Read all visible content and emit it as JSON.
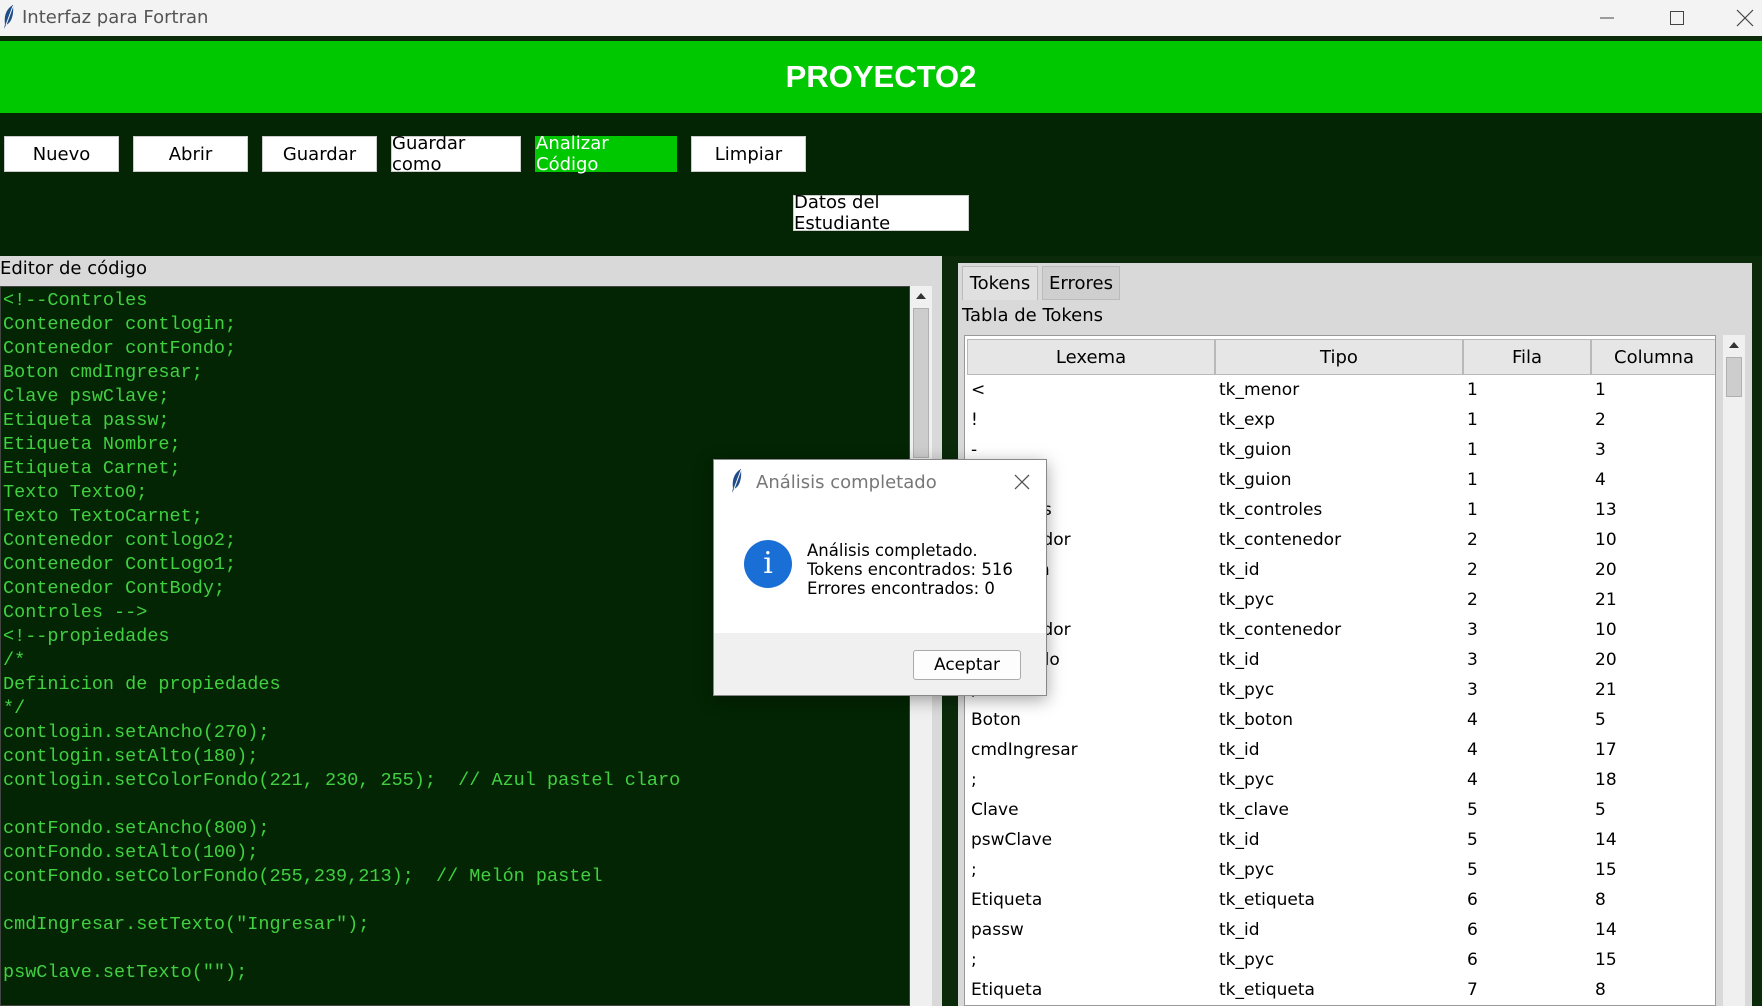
{
  "window": {
    "title": "Interfaz para Fortran"
  },
  "header": {
    "title": "PROYECTO2"
  },
  "toolbar": {
    "nuevo": "Nuevo",
    "abrir": "Abrir",
    "guardar": "Guardar",
    "guardar_como": "Guardar como",
    "analizar": "Analizar Código",
    "limpiar": "Limpiar",
    "datos": "Datos del Estudiante",
    "accent_color": "#00c800"
  },
  "editor": {
    "label": "Editor de código",
    "lines": [
      "<!--Controles",
      "Contenedor contlogin;",
      "Contenedor contFondo;",
      "Boton cmdIngresar;",
      "Clave pswClave;",
      "Etiqueta passw;",
      "Etiqueta Nombre;",
      "Etiqueta Carnet;",
      "Texto Texto0;",
      "Texto TextoCarnet;",
      "Contenedor contlogo2;",
      "Contenedor ContLogo1;",
      "Contenedor ContBody;",
      "Controles -->",
      "<!--propiedades",
      "/*",
      "Definicion de propiedades",
      "*/",
      "contlogin.setAncho(270);",
      "contlogin.setAlto(180);",
      "contlogin.setColorFondo(221, 230, 255);  // Azul pastel claro",
      "",
      "contFondo.setAncho(800);",
      "contFondo.setAlto(100);",
      "contFondo.setColorFondo(255,239,213);  // Melón pastel",
      "",
      "cmdIngresar.setTexto(\"Ingresar\");",
      "",
      "pswClave.setTexto(\"\");"
    ]
  },
  "tabs": {
    "tokens": "Tokens",
    "errores": "Errores"
  },
  "tokens_table": {
    "label": "Tabla de Tokens",
    "headers": {
      "lexema": "Lexema",
      "tipo": "Tipo",
      "fila": "Fila",
      "columna": "Columna"
    },
    "rows": [
      [
        "<",
        "tk_menor",
        "1",
        "1"
      ],
      [
        "!",
        "tk_exp",
        "1",
        "2"
      ],
      [
        "-",
        "tk_guion",
        "1",
        "3"
      ],
      [
        "-",
        "tk_guion",
        "1",
        "4"
      ],
      [
        "Controles",
        "tk_controles",
        "1",
        "13"
      ],
      [
        "Contenedor",
        "tk_contenedor",
        "2",
        "10"
      ],
      [
        "contlogin",
        "tk_id",
        "2",
        "20"
      ],
      [
        ";",
        "tk_pyc",
        "2",
        "21"
      ],
      [
        "Contenedor",
        "tk_contenedor",
        "3",
        "10"
      ],
      [
        "contFondo",
        "tk_id",
        "3",
        "20"
      ],
      [
        ";",
        "tk_pyc",
        "3",
        "21"
      ],
      [
        "Boton",
        "tk_boton",
        "4",
        "5"
      ],
      [
        "cmdIngresar",
        "tk_id",
        "4",
        "17"
      ],
      [
        ";",
        "tk_pyc",
        "4",
        "18"
      ],
      [
        "Clave",
        "tk_clave",
        "5",
        "5"
      ],
      [
        "pswClave",
        "tk_id",
        "5",
        "14"
      ],
      [
        ";",
        "tk_pyc",
        "5",
        "15"
      ],
      [
        "Etiqueta",
        "tk_etiqueta",
        "6",
        "8"
      ],
      [
        "passw",
        "tk_id",
        "6",
        "14"
      ],
      [
        ";",
        "tk_pyc",
        "6",
        "15"
      ],
      [
        "Etiqueta",
        "tk_etiqueta",
        "7",
        "8"
      ]
    ]
  },
  "dialog": {
    "title": "Análisis completado",
    "line1": "Análisis completado.",
    "line2": "Tokens encontrados: 516",
    "line3": "Errores encontrados: 0",
    "ok": "Aceptar"
  }
}
